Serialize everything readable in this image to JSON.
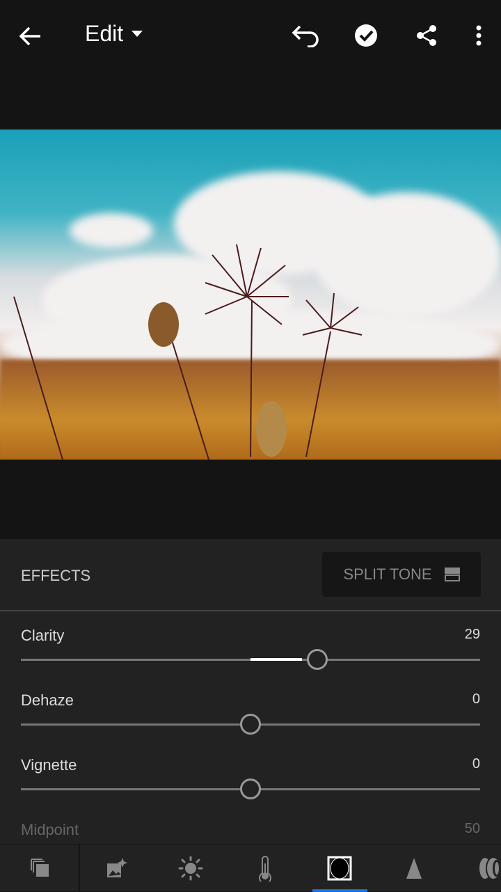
{
  "header": {
    "title": "Edit",
    "back_icon": "arrow-left-icon",
    "dropdown_icon": "caret-down-icon",
    "undo_icon": "undo-icon",
    "done_icon": "check-circle-icon",
    "share_icon": "share-icon",
    "more_icon": "more-vertical-icon"
  },
  "panel": {
    "section_title": "EFFECTS",
    "split_tone_label": "SPLIT TONE",
    "split_tone_icon": "split-tone-icon"
  },
  "sliders": [
    {
      "label": "Clarity",
      "value": "29",
      "level": 29,
      "min": -100,
      "max": 100
    },
    {
      "label": "Dehaze",
      "value": "0",
      "level": 0,
      "min": -100,
      "max": 100
    },
    {
      "label": "Vignette",
      "value": "0",
      "level": 0,
      "min": -100,
      "max": 100
    },
    {
      "label": "Midpoint",
      "value": "50",
      "disabled": true
    }
  ],
  "toolbar": {
    "items": [
      "presets-icon",
      "auto-enhance-icon",
      "light-icon",
      "color-temperature-icon",
      "effects-icon",
      "detail-icon",
      "optics-icon"
    ],
    "active": "effects-icon",
    "accent": "#1473e6"
  }
}
